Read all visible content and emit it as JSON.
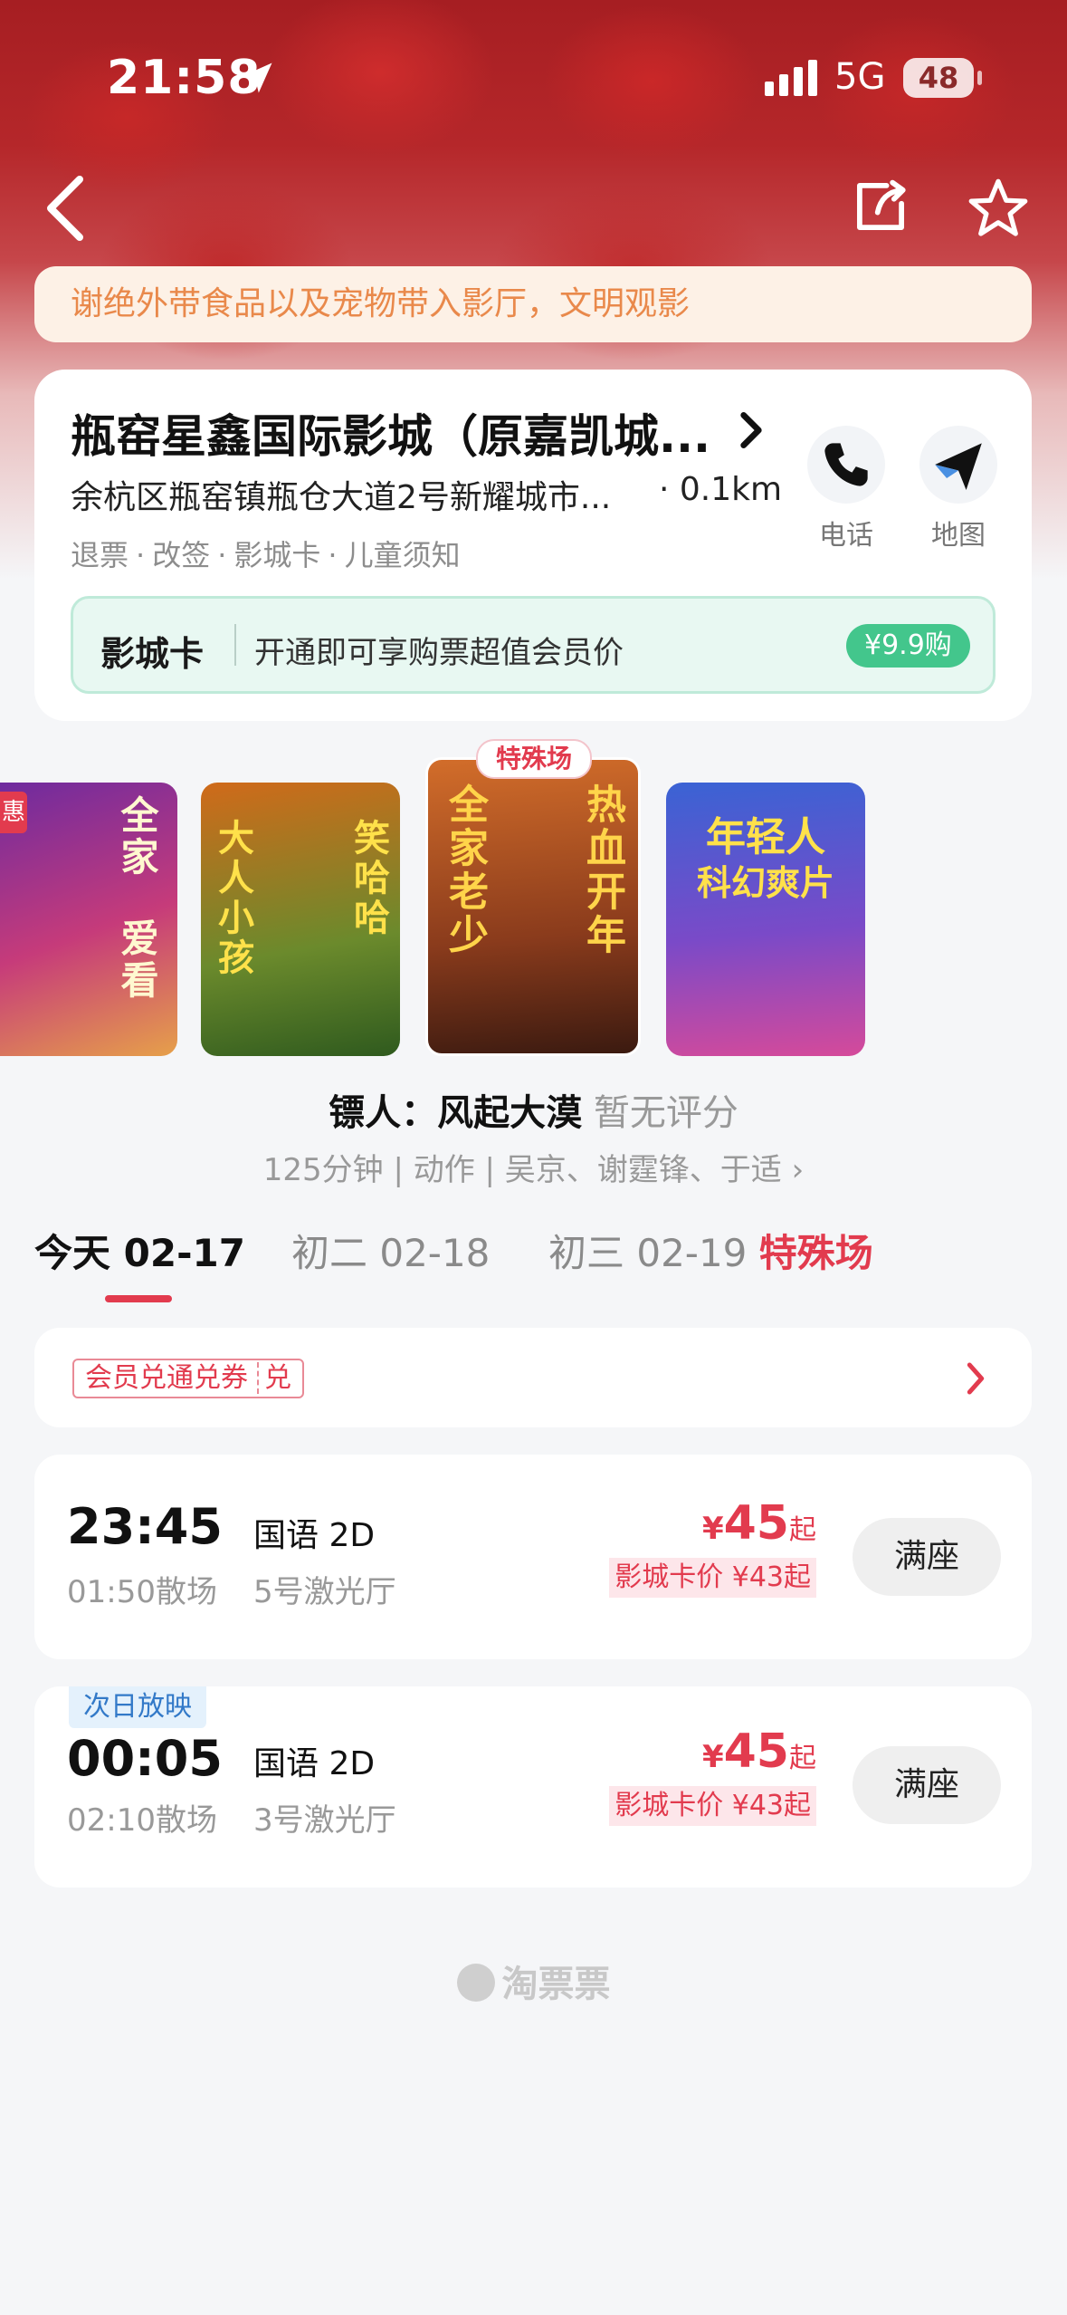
{
  "status": {
    "time": "21:58",
    "network": "5G",
    "battery": "48"
  },
  "notice": "谢绝外带食品以及宠物带入影厅，文明观影",
  "cinema": {
    "name": "瓶窑星鑫国际影城（原嘉凯城...",
    "address": "余杭区瓶窑镇瓶仓大道2号新耀城市...",
    "distance": "· 0.1km",
    "tags": [
      "退票",
      "改签",
      "影城卡",
      "儿童须知"
    ],
    "phone_label": "电话",
    "map_label": "地图"
  },
  "member_card": {
    "title": "影城卡",
    "desc": "开通即可享购票超值会员价",
    "price": "¥9.9购"
  },
  "posters": [
    {
      "name": "poster-1",
      "text_a": "全家",
      "text_b": "爱看",
      "badge": "惠"
    },
    {
      "name": "poster-2",
      "text_a": "大人小孩",
      "text_b": "笑哈哈"
    },
    {
      "name": "poster-3",
      "text_a": "全家老少",
      "text_b": "热血开年",
      "badge": "特殊场"
    },
    {
      "name": "poster-4",
      "text_a": "年轻人",
      "text_b": "科幻爽片"
    }
  ],
  "movie": {
    "title": "镖人：风起大漠",
    "rating": "暂无评分",
    "meta": "125分钟 | 动作 | 吴京、谢霆锋、于适 ›"
  },
  "dates": [
    {
      "label": "今天 02-17",
      "active": true
    },
    {
      "label": "初二 02-18",
      "active": false
    },
    {
      "label": "初三 02-19",
      "active": false,
      "special": "特殊场"
    }
  ],
  "coupon": {
    "label": "会员兑通兑券",
    "suffix": "兑"
  },
  "showtimes": [
    {
      "start": "23:45",
      "end": "01:50散场",
      "lang": "国语 2D",
      "hall": "5号激光厅",
      "currency": "¥",
      "price": "45",
      "price_suffix": "起",
      "card_price": "影城卡价 ¥43起",
      "button": "满座"
    },
    {
      "badge": "次日放映",
      "start": "00:05",
      "end": "02:10散场",
      "lang": "国语 2D",
      "hall": "3号激光厅",
      "currency": "¥",
      "price": "45",
      "price_suffix": "起",
      "card_price": "影城卡价 ¥43起",
      "button": "满座"
    }
  ],
  "footer": {
    "brand": "淘票票"
  }
}
